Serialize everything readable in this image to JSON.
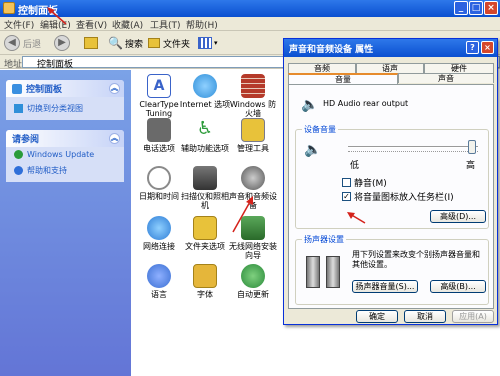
{
  "window": {
    "title": "控制面板"
  },
  "menubar": [
    "文件(F)",
    "编辑(E)",
    "查看(V)",
    "收藏(A)",
    "工具(T)",
    "帮助(H)"
  ],
  "toolbar": {
    "back": "后退",
    "search": "搜索",
    "folders": "文件夹"
  },
  "address": {
    "label": "地址(D)",
    "value": "控制面板"
  },
  "sidebar": {
    "panel1": {
      "title": "控制面板",
      "items": [
        "切换到分类视图"
      ]
    },
    "panel2": {
      "title": "请参阅",
      "items": [
        "Windows Update",
        "帮助和支持"
      ]
    }
  },
  "icons": [
    {
      "label": "ClearType Tuning",
      "name": "cleartype-icon",
      "color": "#3a63c9"
    },
    {
      "label": "Internet 选项",
      "name": "internet-options-icon",
      "color": "#2f8fd9"
    },
    {
      "label": "Windows 防火墙",
      "name": "firewall-icon",
      "color": "#b53a2a"
    },
    {
      "label": "电话选项",
      "name": "phone-icon",
      "color": "#6a6a6a"
    },
    {
      "label": "辅助功能选项",
      "name": "accessibility-icon",
      "color": "#2c9b3a"
    },
    {
      "label": "管理工具",
      "name": "admin-tools-icon",
      "color": "#7a7a8a"
    },
    {
      "label": "日期和时间",
      "name": "date-time-icon",
      "color": "#d9d9d9"
    },
    {
      "label": "扫描仪和照相机",
      "name": "scanner-icon",
      "color": "#5a5a5a"
    },
    {
      "label": "声音和音频设备",
      "name": "sound-icon",
      "color": "#8a8a8a"
    },
    {
      "label": "网络连接",
      "name": "network-icon",
      "color": "#2d7cd6"
    },
    {
      "label": "文件夹选项",
      "name": "folder-options-icon",
      "color": "#e8c23a"
    },
    {
      "label": "无线网络安装向导",
      "name": "wireless-icon",
      "color": "#3b8a3a"
    },
    {
      "label": "语言",
      "name": "language-icon",
      "color": "#3a6fd3"
    },
    {
      "label": "字体",
      "name": "fonts-icon",
      "color": "#e5b63a"
    },
    {
      "label": "自动更新",
      "name": "auto-update-icon",
      "color": "#2a8a3a"
    }
  ],
  "dialog": {
    "title": "声音和音频设备 属性",
    "tabs_top": [
      "音频",
      "语声",
      "硬件"
    ],
    "tabs_bottom": [
      "音量",
      "声音"
    ],
    "device": "HD Audio rear output",
    "group_volume": "设备音量",
    "low": "低",
    "high": "高",
    "mute": "静音(M)",
    "tray": "将音量图标放入任务栏(I)",
    "advanced": "高级(D)...",
    "group_speaker": "扬声器设置",
    "speaker_desc": "用下列设置来改变个别扬声器音量和其他设置。",
    "speaker_volume": "扬声器音量(S)...",
    "advanced2": "高级(B)...",
    "ok": "确定",
    "cancel": "取消",
    "apply": "应用(A)"
  }
}
